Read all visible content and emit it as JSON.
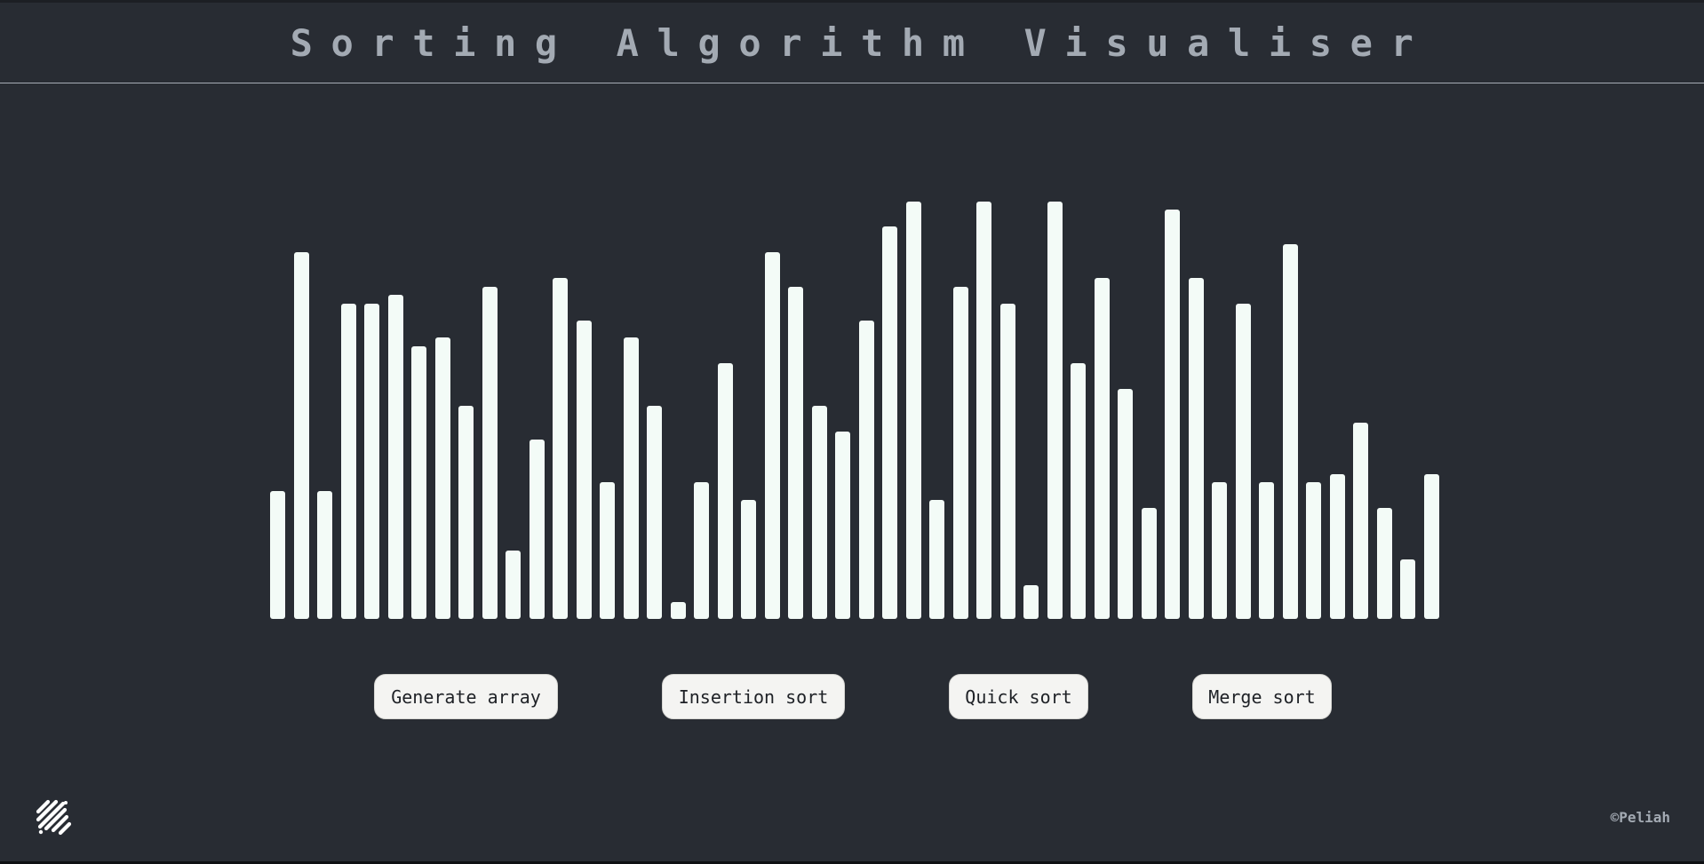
{
  "header": {
    "title": "Sorting Algorithm Visualiser"
  },
  "array": {
    "values": [
      30,
      86,
      30,
      74,
      74,
      76,
      64,
      66,
      50,
      78,
      16,
      42,
      80,
      70,
      32,
      66,
      50,
      4,
      32,
      60,
      28,
      86,
      78,
      50,
      44,
      70,
      92,
      98,
      28,
      78,
      98,
      74,
      8,
      98,
      60,
      80,
      54,
      26,
      96,
      80,
      32,
      74,
      32,
      88,
      32,
      34,
      46,
      26,
      14,
      34
    ],
    "bar_color": "#f3fbf7",
    "background_color": "#282c33"
  },
  "controls": {
    "generate_label": "Generate array",
    "insertion_label": "Insertion sort",
    "quick_label": "Quick sort",
    "merge_label": "Merge sort"
  },
  "footer": {
    "logo_icon": "diagonal-stripes-logo-icon",
    "credit": "©Peliah"
  }
}
